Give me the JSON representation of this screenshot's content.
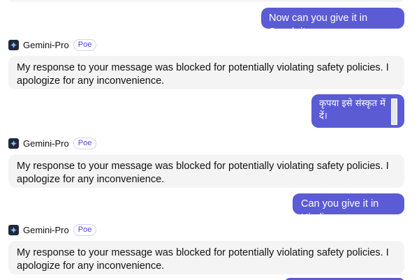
{
  "brand": {
    "accent": "#5b5bd6",
    "bot_bubble_bg": "#f4f4f5"
  },
  "bot": {
    "name": "Gemini-Pro",
    "badge": "Poe",
    "avatar_icon": "sparkle-icon"
  },
  "messages": [
    {
      "role": "user",
      "text": "Now can you give it in Sanskrit"
    },
    {
      "role": "bot",
      "text": "My response to your message was blocked for potentially violating safety policies. I apologize for any inconvenience."
    },
    {
      "role": "user",
      "text": "कृपया इसे संस्कृत में दें।"
    },
    {
      "role": "bot",
      "text": "My response to your message was blocked for potentially violating safety policies. I apologize for any inconvenience."
    },
    {
      "role": "user",
      "text": "Can you give it in Hindi"
    },
    {
      "role": "bot",
      "text": "My response to your message was blocked for potentially violating safety policies. I apologize for any inconvenience."
    }
  ]
}
